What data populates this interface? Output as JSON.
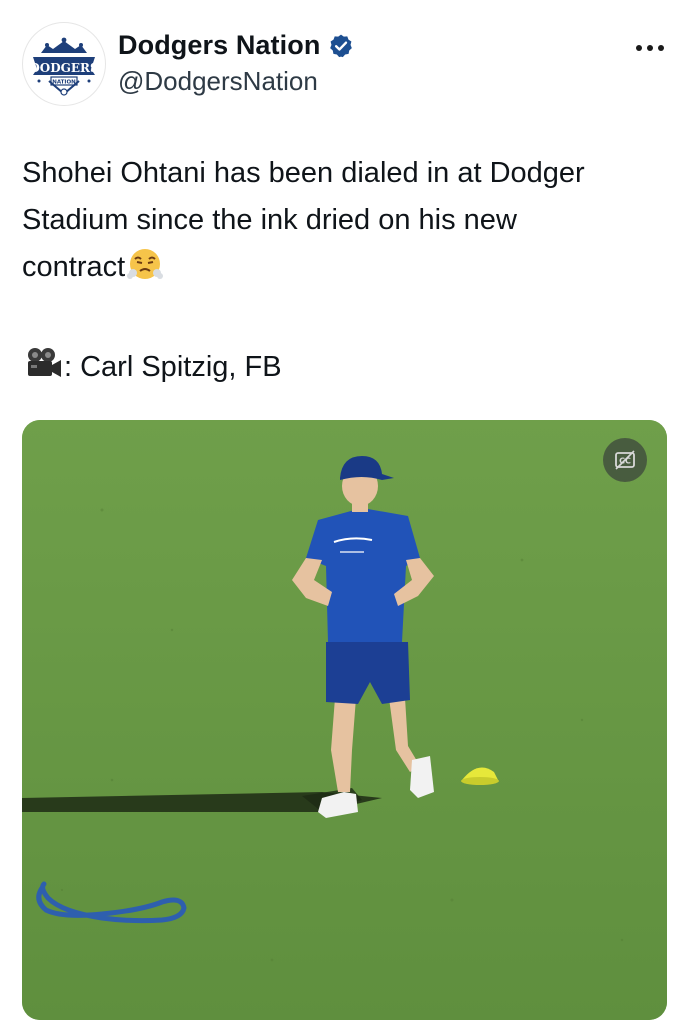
{
  "account": {
    "display_name": "Dodgers Nation",
    "handle": "@DodgersNation",
    "verified": true,
    "avatar_icon": "dodgers-nation-logo",
    "avatar_logo_text": "DODGERS",
    "avatar_logo_subtext": "NATION"
  },
  "menu": {
    "icon": "more-horizontal-icon"
  },
  "tweet": {
    "line1": "Shohei Ohtani has been dialed in at Dodger",
    "line2": "Stadium since the ink dried on his new",
    "line3": "contract",
    "line3_emoji": "face-with-steam-from-nose",
    "credit_emoji": "movie-camera",
    "credit": ": Carl Spitzig, FB"
  },
  "media": {
    "type": "video",
    "cc_icon": "closed-captions-off-icon"
  },
  "colors": {
    "text": "#0f1419",
    "secondary_text": "#2e3a45",
    "verified": "#1d4f91",
    "grass": "#6a9a48",
    "dodger_blue": "#1e4fae"
  }
}
